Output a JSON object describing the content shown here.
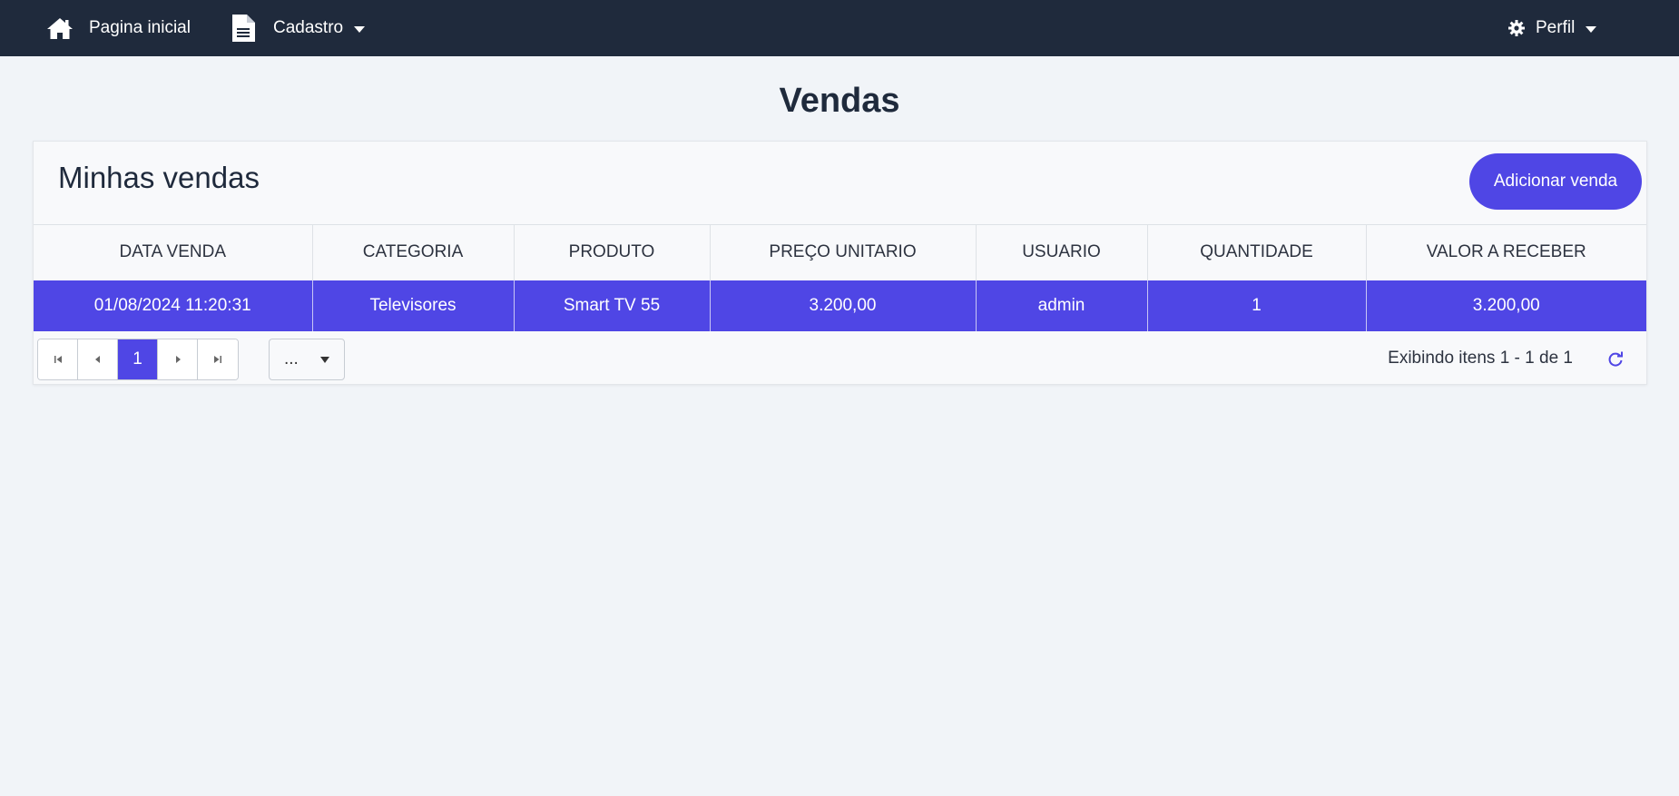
{
  "nav": {
    "home_label": "Pagina inicial",
    "cadastro_label": "Cadastro",
    "perfil_label": "Perfil",
    "icons": {
      "home": "home-icon",
      "cadastro": "document-icon",
      "perfil": "gear-icon"
    }
  },
  "page": {
    "title": "Vendas"
  },
  "card": {
    "title": "Minhas vendas",
    "add_button_label": "Adicionar venda"
  },
  "table": {
    "columns": [
      "DATA VENDA",
      "CATEGORIA",
      "PRODUTO",
      "PREÇO UNITARIO",
      "USUARIO",
      "QUANTIDADE",
      "VALOR A RECEBER"
    ],
    "rows": [
      [
        "01/08/2024 11:20:31",
        "Televisores",
        "Smart TV 55",
        "3.200,00",
        "admin",
        "1",
        "3.200,00"
      ]
    ]
  },
  "pager": {
    "current_page": "1",
    "page_size": "...",
    "info": "Exibindo itens 1 - 1 de 1"
  },
  "colors": {
    "navbar": "#1f2a3c",
    "accent": "#4f46e5",
    "background": "#f1f4f8"
  }
}
